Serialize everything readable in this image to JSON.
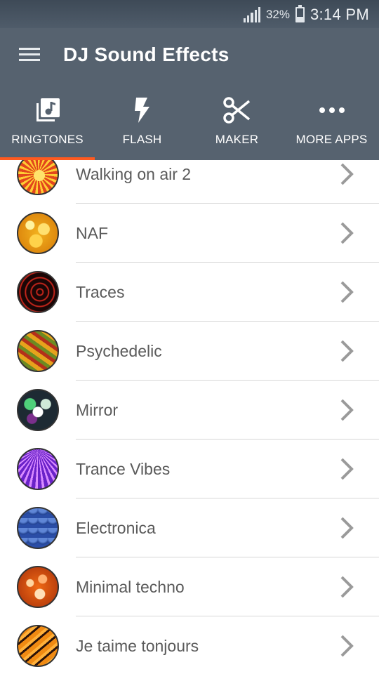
{
  "status_bar": {
    "battery_percent": "32%",
    "time": "3:14 PM",
    "battery_level": 0.32
  },
  "app_bar": {
    "menu_icon": "hamburger-menu-icon",
    "title": "DJ Sound Effects",
    "background": "#56626f"
  },
  "tabs": [
    {
      "label": "RINGTONES",
      "icon": "music-library-icon",
      "selected": true
    },
    {
      "label": "FLASH",
      "icon": "flash-icon",
      "selected": false
    },
    {
      "label": "MAKER",
      "icon": "scissors-icon",
      "selected": false
    },
    {
      "label": "MORE APPS",
      "icon": "more-dots-icon",
      "selected": false
    }
  ],
  "accent_color": "#ff5a1f",
  "ringtones": [
    {
      "title": "Walking on air 2",
      "thumb": "orange-sunburst"
    },
    {
      "title": "NAF",
      "thumb": "yellow-bokeh"
    },
    {
      "title": "Traces",
      "thumb": "red-swirl"
    },
    {
      "title": "Psychedelic",
      "thumb": "green-orange-waves"
    },
    {
      "title": "Mirror",
      "thumb": "green-hexagons"
    },
    {
      "title": "Trance Vibes",
      "thumb": "purple-rays"
    },
    {
      "title": "Electronica",
      "thumb": "blue-scales"
    },
    {
      "title": "Minimal techno",
      "thumb": "orange-bubbles"
    },
    {
      "title": "Je taime tonjours",
      "thumb": "orange-tiger-stripes"
    }
  ]
}
